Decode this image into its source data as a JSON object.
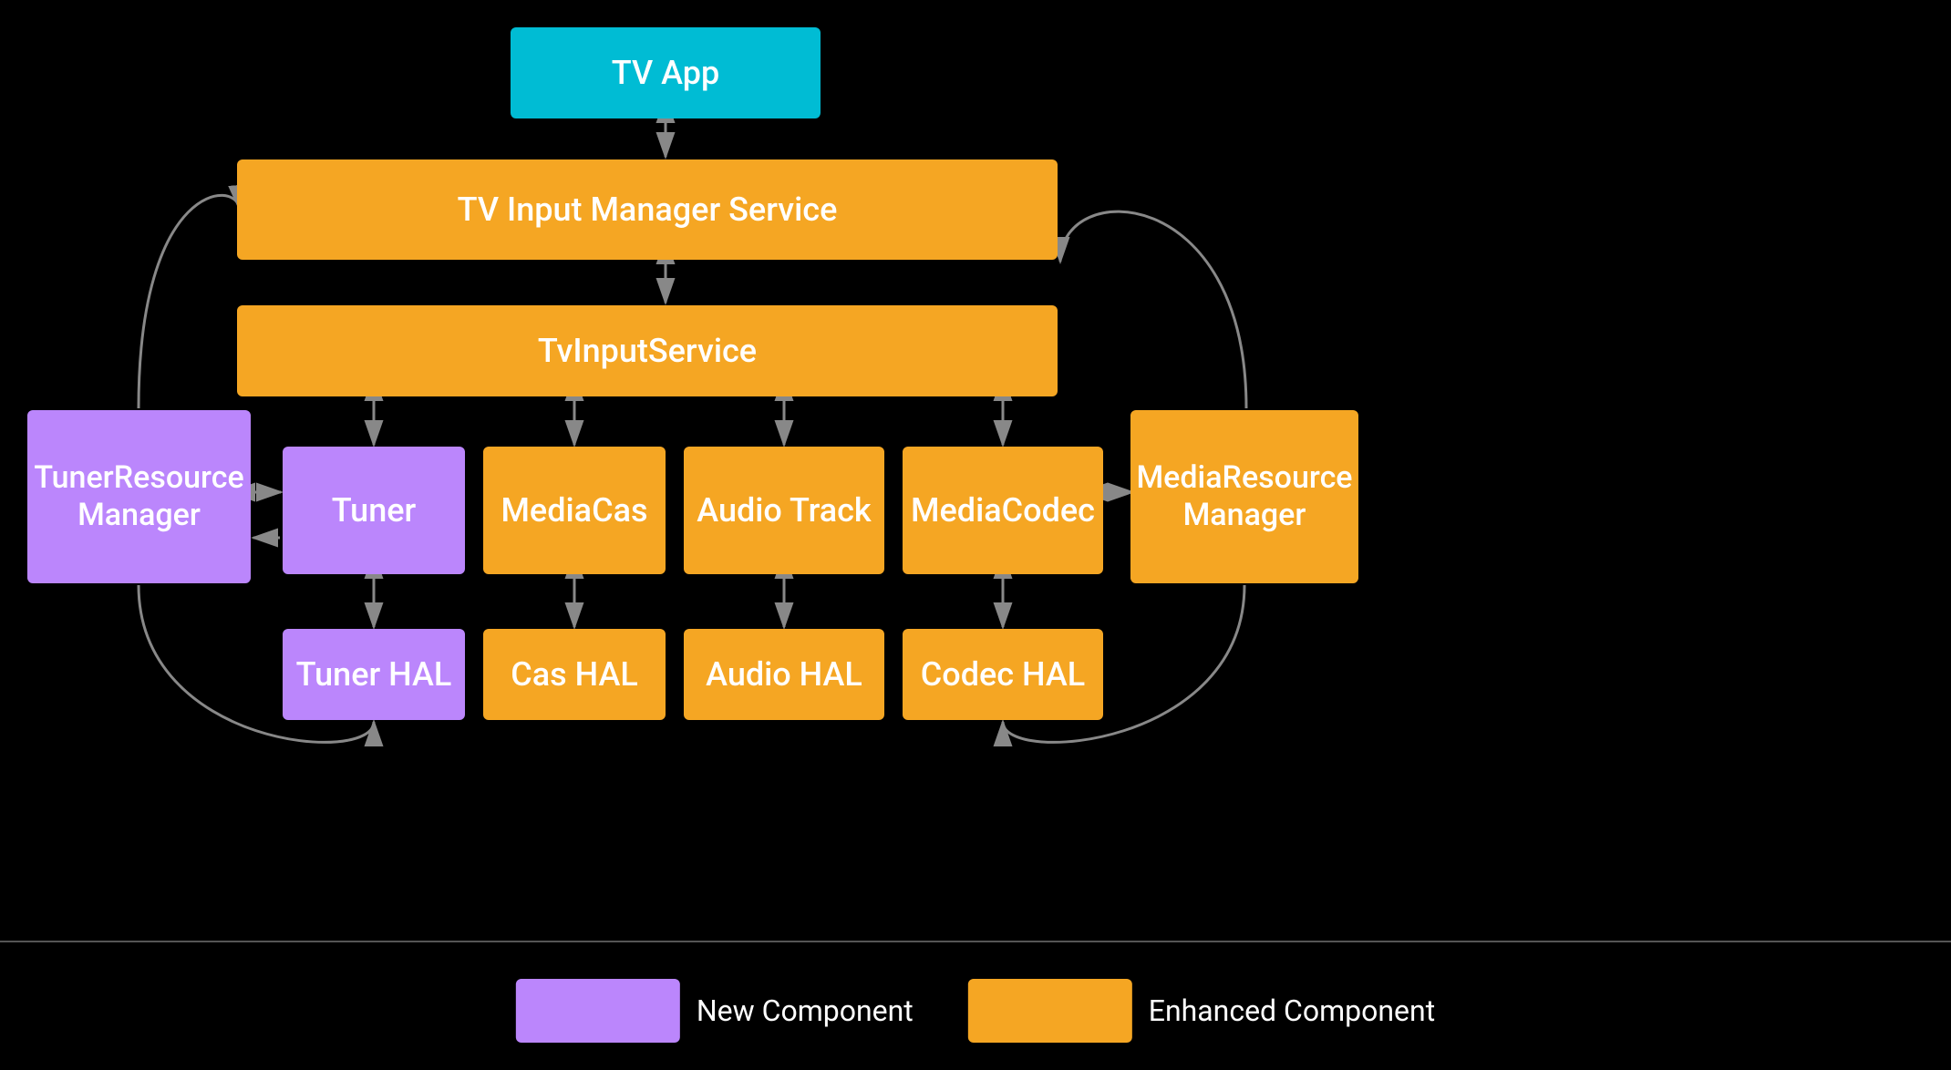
{
  "boxes": {
    "tv_app": "TV App",
    "tv_input_manager": "TV Input Manager Service",
    "tv_input_service": "TvInputService",
    "tuner": "Tuner",
    "mediacas": "MediaCas",
    "audio_track": "Audio Track",
    "mediacodec": "MediaCodec",
    "tuner_hal": "Tuner HAL",
    "cas_hal": "Cas HAL",
    "audio_hal": "Audio HAL",
    "codec_hal": "Codec HAL",
    "tuner_resource": "TunerResource\nManager",
    "media_resource": "MediaResource\nManager"
  },
  "legend": {
    "new_component": "New Component",
    "enhanced_component": "Enhanced Component"
  },
  "colors": {
    "orange": "#F5A623",
    "purple": "#BB86FC",
    "cyan": "#00BCD4",
    "background": "#000000",
    "arrow": "#888888"
  }
}
